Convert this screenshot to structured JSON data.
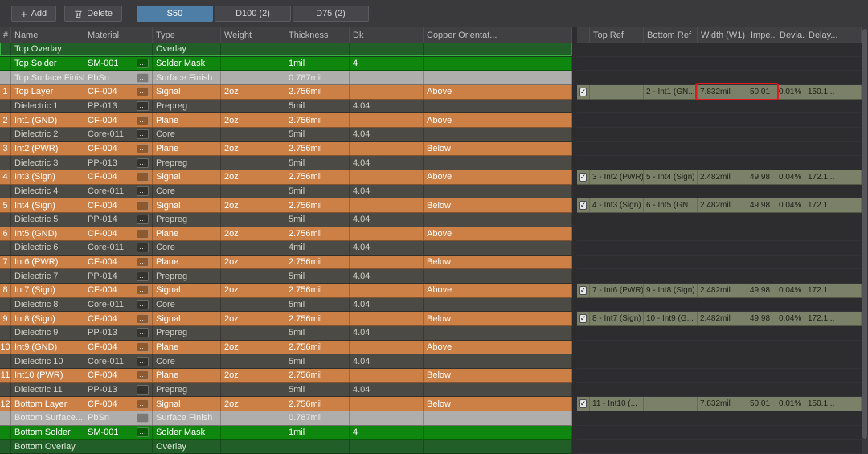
{
  "toolbar": {
    "add_label": "Add",
    "delete_label": "Delete",
    "tabs": [
      {
        "label": "S50",
        "active": true
      },
      {
        "label": "D100 (2)",
        "active": false
      },
      {
        "label": "D75 (2)",
        "active": false
      }
    ]
  },
  "left_table": {
    "headers": [
      "#",
      "Name",
      "Material",
      "Type",
      "Weight",
      "Thickness",
      "Dk",
      "Copper Orientat..."
    ],
    "rows": [
      {
        "num": "",
        "name": "Top Overlay",
        "material": "",
        "type": "Overlay",
        "weight": "",
        "thickness": "",
        "dk": "",
        "orientation": "",
        "kind": "overlay",
        "selected": true
      },
      {
        "num": "",
        "name": "Top Solder",
        "material": "SM-001",
        "type": "Solder Mask",
        "weight": "",
        "thickness": "1mil",
        "dk": "4",
        "orientation": "",
        "kind": "solder"
      },
      {
        "num": "",
        "name": "Top Surface Finish",
        "material": "PbSn",
        "type": "Surface Finish",
        "weight": "",
        "thickness": "0.787mil",
        "dk": "",
        "orientation": "",
        "kind": "finish"
      },
      {
        "num": "1",
        "name": "Top Layer",
        "material": "CF-004",
        "type": "Signal",
        "weight": "2oz",
        "thickness": "2.756mil",
        "dk": "",
        "orientation": "Above",
        "kind": "copper"
      },
      {
        "num": "",
        "name": "Dielectric 1",
        "material": "PP-013",
        "type": "Prepreg",
        "weight": "",
        "thickness": "5mil",
        "dk": "4.04",
        "orientation": "",
        "kind": "dielectric"
      },
      {
        "num": "2",
        "name": "Int1 (GND)",
        "material": "CF-004",
        "type": "Plane",
        "weight": "2oz",
        "thickness": "2.756mil",
        "dk": "",
        "orientation": "Above",
        "kind": "copper"
      },
      {
        "num": "",
        "name": "Dielectric 2",
        "material": "Core-011",
        "type": "Core",
        "weight": "",
        "thickness": "5mil",
        "dk": "4.04",
        "orientation": "",
        "kind": "dielectric"
      },
      {
        "num": "3",
        "name": "Int2 (PWR)",
        "material": "CF-004",
        "type": "Plane",
        "weight": "2oz",
        "thickness": "2.756mil",
        "dk": "",
        "orientation": "Below",
        "kind": "copper"
      },
      {
        "num": "",
        "name": "Dielectric 3",
        "material": "PP-013",
        "type": "Prepreg",
        "weight": "",
        "thickness": "5mil",
        "dk": "4.04",
        "orientation": "",
        "kind": "dielectric"
      },
      {
        "num": "4",
        "name": "Int3 (Sign)",
        "material": "CF-004",
        "type": "Signal",
        "weight": "2oz",
        "thickness": "2.756mil",
        "dk": "",
        "orientation": "Above",
        "kind": "copper"
      },
      {
        "num": "",
        "name": "Dielectric 4",
        "material": "Core-011",
        "type": "Core",
        "weight": "",
        "thickness": "5mil",
        "dk": "4.04",
        "orientation": "",
        "kind": "dielectric"
      },
      {
        "num": "5",
        "name": "Int4 (Sign)",
        "material": "CF-004",
        "type": "Signal",
        "weight": "2oz",
        "thickness": "2.756mil",
        "dk": "",
        "orientation": "Below",
        "kind": "copper"
      },
      {
        "num": "",
        "name": "Dielectric 5",
        "material": "PP-014",
        "type": "Prepreg",
        "weight": "",
        "thickness": "5mil",
        "dk": "4.04",
        "orientation": "",
        "kind": "dielectric"
      },
      {
        "num": "6",
        "name": "Int5 (GND)",
        "material": "CF-004",
        "type": "Plane",
        "weight": "2oz",
        "thickness": "2.756mil",
        "dk": "",
        "orientation": "Above",
        "kind": "copper"
      },
      {
        "num": "",
        "name": "Dielectric 6",
        "material": "Core-011",
        "type": "Core",
        "weight": "",
        "thickness": "4mil",
        "dk": "4.04",
        "orientation": "",
        "kind": "dielectric"
      },
      {
        "num": "7",
        "name": "Int6 (PWR)",
        "material": "CF-004",
        "type": "Plane",
        "weight": "2oz",
        "thickness": "2.756mil",
        "dk": "",
        "orientation": "Below",
        "kind": "copper"
      },
      {
        "num": "",
        "name": "Dielectric 7",
        "material": "PP-014",
        "type": "Prepreg",
        "weight": "",
        "thickness": "5mil",
        "dk": "4.04",
        "orientation": "",
        "kind": "dielectric"
      },
      {
        "num": "8",
        "name": "Int7 (Sign)",
        "material": "CF-004",
        "type": "Signal",
        "weight": "2oz",
        "thickness": "2.756mil",
        "dk": "",
        "orientation": "Above",
        "kind": "copper"
      },
      {
        "num": "",
        "name": "Dielectric 8",
        "material": "Core-011",
        "type": "Core",
        "weight": "",
        "thickness": "5mil",
        "dk": "4.04",
        "orientation": "",
        "kind": "dielectric"
      },
      {
        "num": "9",
        "name": "Int8 (Sign)",
        "material": "CF-004",
        "type": "Signal",
        "weight": "2oz",
        "thickness": "2.756mil",
        "dk": "",
        "orientation": "Below",
        "kind": "copper"
      },
      {
        "num": "",
        "name": "Dielectric 9",
        "material": "PP-013",
        "type": "Prepreg",
        "weight": "",
        "thickness": "5mil",
        "dk": "4.04",
        "orientation": "",
        "kind": "dielectric"
      },
      {
        "num": "10",
        "name": "Int9 (GND)",
        "material": "CF-004",
        "type": "Plane",
        "weight": "2oz",
        "thickness": "2.756mil",
        "dk": "",
        "orientation": "Above",
        "kind": "copper"
      },
      {
        "num": "",
        "name": "Dielectric 10",
        "material": "Core-011",
        "type": "Core",
        "weight": "",
        "thickness": "5mil",
        "dk": "4.04",
        "orientation": "",
        "kind": "dielectric"
      },
      {
        "num": "11",
        "name": "Int10 (PWR)",
        "material": "CF-004",
        "type": "Plane",
        "weight": "2oz",
        "thickness": "2.756mil",
        "dk": "",
        "orientation": "Below",
        "kind": "copper"
      },
      {
        "num": "",
        "name": "Dielectric 11",
        "material": "PP-013",
        "type": "Prepreg",
        "weight": "",
        "thickness": "5mil",
        "dk": "4.04",
        "orientation": "",
        "kind": "dielectric"
      },
      {
        "num": "12",
        "name": "Bottom Layer",
        "material": "CF-004",
        "type": "Signal",
        "weight": "2oz",
        "thickness": "2.756mil",
        "dk": "",
        "orientation": "Below",
        "kind": "copper"
      },
      {
        "num": "",
        "name": "Bottom Surface...",
        "material": "PbSn",
        "type": "Surface Finish",
        "weight": "",
        "thickness": "0.787mil",
        "dk": "",
        "orientation": "",
        "kind": "finish"
      },
      {
        "num": "",
        "name": "Bottom Solder",
        "material": "SM-001",
        "type": "Solder Mask",
        "weight": "",
        "thickness": "1mil",
        "dk": "4",
        "orientation": "",
        "kind": "solder"
      },
      {
        "num": "",
        "name": "Bottom Overlay",
        "material": "",
        "type": "Overlay",
        "weight": "",
        "thickness": "",
        "dk": "",
        "orientation": "",
        "kind": "overlay"
      }
    ]
  },
  "right_table": {
    "headers": [
      "",
      "Top Ref",
      "Bottom Ref",
      "Width (W1)",
      "Impe...",
      "Devia...",
      "Delay..."
    ],
    "rows": [
      {
        "row_index": 3,
        "checked": true,
        "top_ref": "",
        "bottom_ref": "2 - Int1 (GN...",
        "width": "7.832mil",
        "impedance": "50.01",
        "deviation": "0.01%",
        "delay": "150.1...",
        "highlighted": true
      },
      {
        "row_index": 9,
        "checked": true,
        "top_ref": "3 - Int2 (PWR)",
        "bottom_ref": "5 - Int4 (Sign)",
        "width": "2.482mil",
        "impedance": "49.98",
        "deviation": "0.04%",
        "delay": "172.1..."
      },
      {
        "row_index": 11,
        "checked": true,
        "top_ref": "4 - Int3 (Sign)",
        "bottom_ref": "6 - Int5 (GN...",
        "width": "2.482mil",
        "impedance": "49.98",
        "deviation": "0.04%",
        "delay": "172.1..."
      },
      {
        "row_index": 17,
        "checked": true,
        "top_ref": "7 - Int6 (PWR)",
        "bottom_ref": "9 - Int8 (Sign)",
        "width": "2.482mil",
        "impedance": "49.98",
        "deviation": "0.04%",
        "delay": "172.1..."
      },
      {
        "row_index": 19,
        "checked": true,
        "top_ref": "8 - Int7 (Sign)",
        "bottom_ref": "10 - Int9 (G...",
        "width": "2.482mil",
        "impedance": "49.98",
        "deviation": "0.04%",
        "delay": "172.1..."
      },
      {
        "row_index": 25,
        "checked": true,
        "top_ref": "11 - Int10 (...",
        "bottom_ref": "",
        "width": "7.832mil",
        "impedance": "50.01",
        "deviation": "0.01%",
        "delay": "150.1..."
      }
    ]
  },
  "check_glyph": "✓",
  "ellipsis_glyph": "…",
  "colors": {
    "bg": "#2d2d30",
    "toolbar-bg": "#3a3a3d",
    "button-bg": "#48484c",
    "tab-active": "#4e7da6",
    "header-bg": "#404043",
    "header-text": "#bdbdbd",
    "copper": "#cd8046",
    "copper-text": "#ffffff",
    "dielectric": "#4b4a44",
    "dielectric-text": "#cfcec6",
    "solder": "#0f870f",
    "overlay": "#215e28",
    "finish": "#afaeac",
    "finish-text": "#ebebeb",
    "impedance-row": "#7b8068",
    "impedance-text": "#1d1f16",
    "selected-outline": "#3fae49",
    "annotation": "#e01b1b"
  }
}
